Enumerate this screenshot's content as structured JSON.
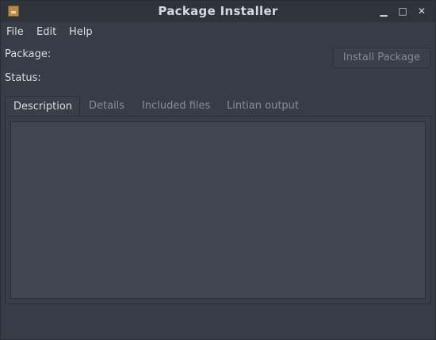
{
  "window": {
    "title": "Package Installer",
    "controls": {
      "minimize": "▁",
      "maximize": "□",
      "close": "✕"
    }
  },
  "menubar": {
    "items": [
      {
        "label": "File"
      },
      {
        "label": "Edit"
      },
      {
        "label": "Help"
      }
    ]
  },
  "fields": {
    "package_label": "Package:",
    "status_label": "Status:"
  },
  "actions": {
    "install_label": "Install Package"
  },
  "tabs": [
    {
      "label": "Description",
      "active": true
    },
    {
      "label": "Details"
    },
    {
      "label": "Included files"
    },
    {
      "label": "Lintian output"
    }
  ],
  "colors": {
    "window_bg": "#383c47",
    "titlebar_bg": "#2f333b",
    "text": "#dcdde0",
    "inactive_text": "#8a8d96",
    "text_area_bg": "#414551"
  },
  "icons": {
    "app": "package-archive-icon"
  }
}
